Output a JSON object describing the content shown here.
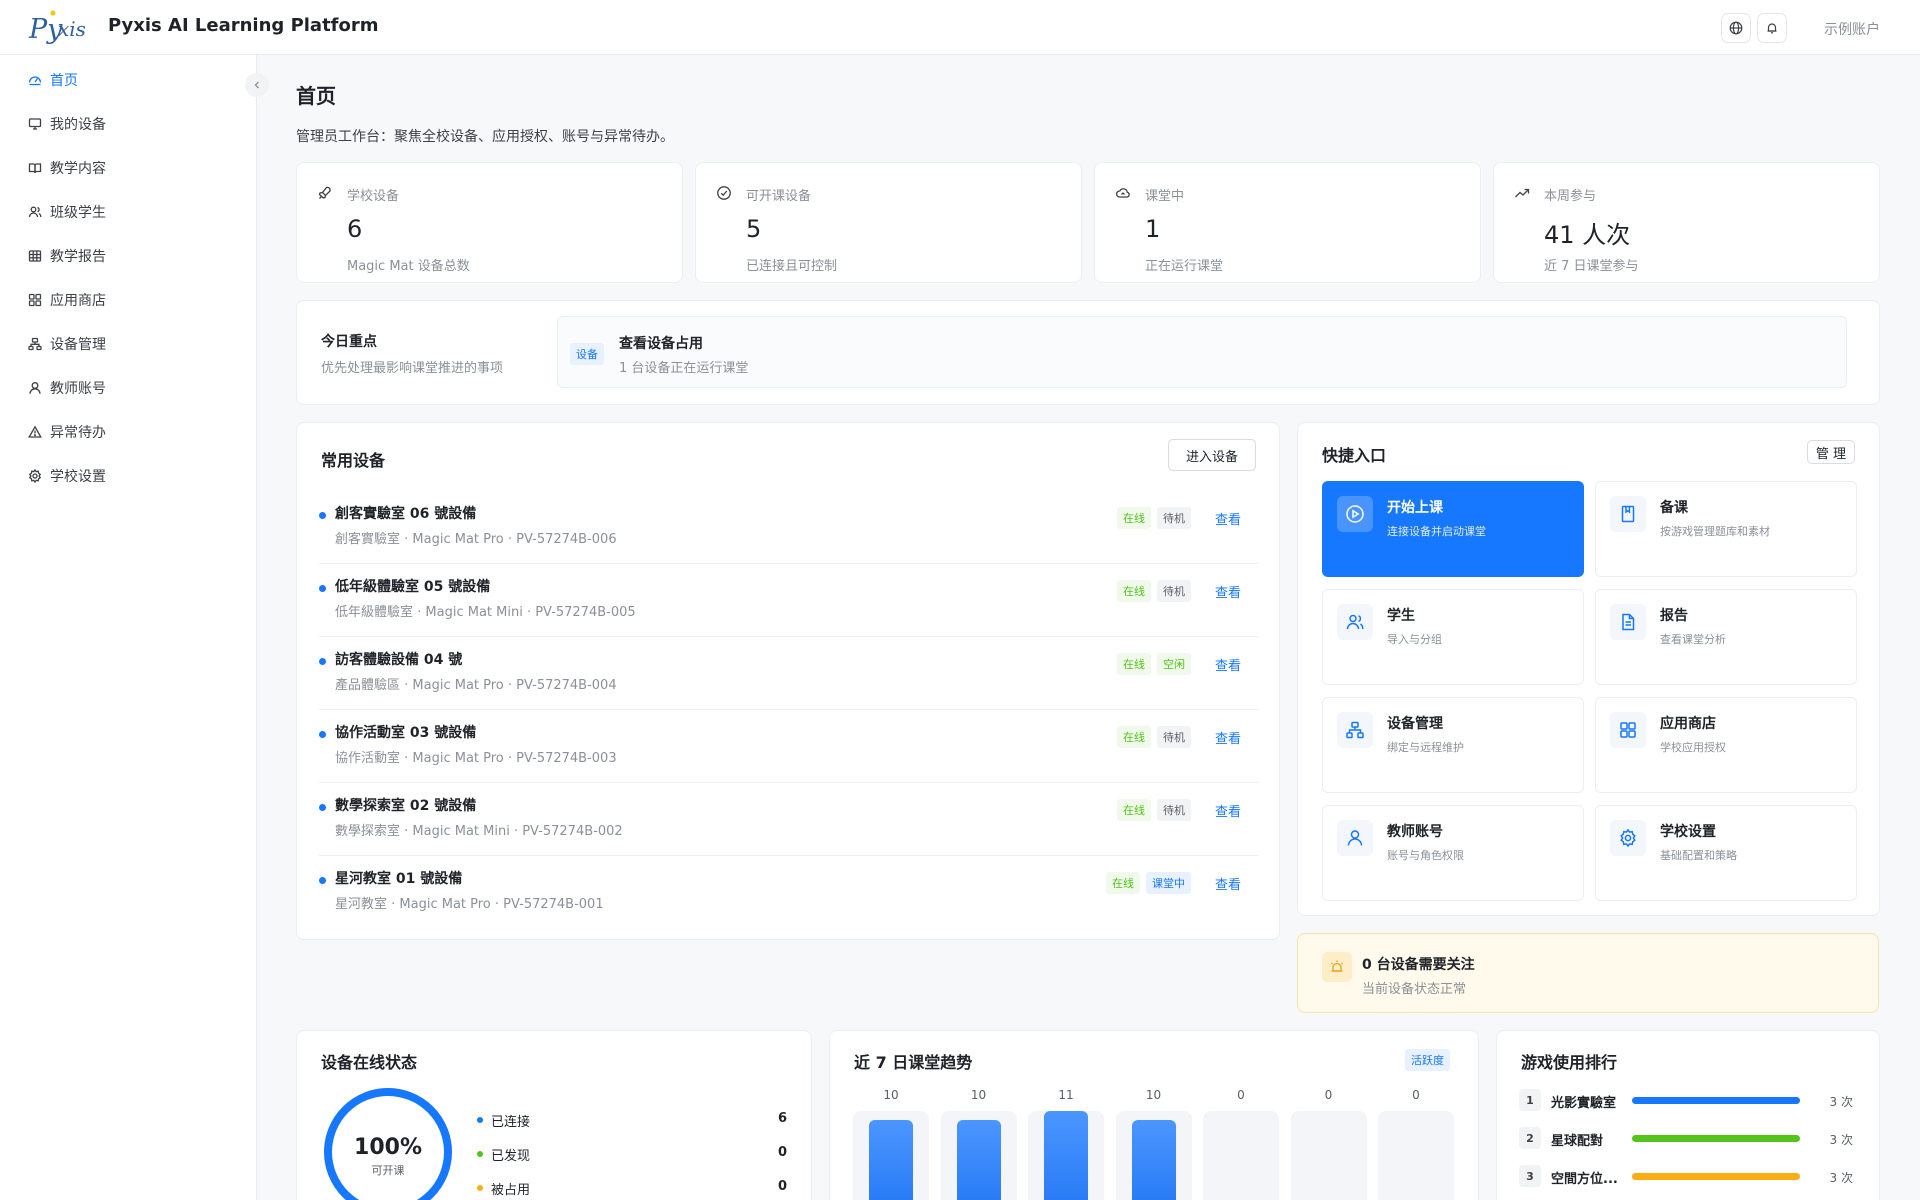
{
  "header": {
    "title": "Pyxis AI Learning Platform",
    "account": "示例账户"
  },
  "sidebar": {
    "items": [
      {
        "label": "首页",
        "icon": "dashboard-icon",
        "active": true
      },
      {
        "label": "我的设备",
        "icon": "monitor-icon"
      },
      {
        "label": "教学内容",
        "icon": "book-icon"
      },
      {
        "label": "班级学生",
        "icon": "students-icon"
      },
      {
        "label": "教学报告",
        "icon": "table-icon"
      },
      {
        "label": "应用商店",
        "icon": "apps-icon"
      },
      {
        "label": "设备管理",
        "icon": "org-icon"
      },
      {
        "label": "教师账号",
        "icon": "user-icon"
      },
      {
        "label": "异常待办",
        "icon": "warning-icon"
      },
      {
        "label": "学校设置",
        "icon": "gear-icon"
      }
    ]
  },
  "page": {
    "title": "首页",
    "subtitle": "管理员工作台：聚焦全校设备、应用授权、账号与异常待办。"
  },
  "stats": [
    {
      "label": "学校设备",
      "value": "6",
      "desc": "Magic Mat 设备总数",
      "icon": "rocket-icon"
    },
    {
      "label": "可开课设备",
      "value": "5",
      "desc": "已连接且可控制",
      "icon": "check-circle-icon"
    },
    {
      "label": "课堂中",
      "value": "1",
      "desc": "正在运行课堂",
      "icon": "cloud-icon"
    },
    {
      "label": "本周参与",
      "value": "41 人次",
      "desc": "近 7 日课堂参与",
      "icon": "trend-icon"
    }
  ],
  "focus": {
    "title": "今日重点",
    "subtitle": "优先处理最影响课堂推进的事项",
    "item": {
      "tag": "设备",
      "title": "查看设备占用",
      "desc": "1 台设备正在运行课堂"
    }
  },
  "devices": {
    "title": "常用设备",
    "enter_label": "进入设备",
    "view_label": "查看",
    "online_label": "在线",
    "rows": [
      {
        "name": "創客實驗室 06 號設備",
        "meta": "創客實驗室 · Magic Mat Pro · PV-57274B-006",
        "state": "待机",
        "state_kind": "idle"
      },
      {
        "name": "低年級體驗室 05 號設備",
        "meta": "低年級體驗室 · Magic Mat Mini · PV-57274B-005",
        "state": "待机",
        "state_kind": "idle"
      },
      {
        "name": "訪客體驗設備 04 號",
        "meta": "產品體驗區 · Magic Mat Pro · PV-57274B-004",
        "state": "空闲",
        "state_kind": "free"
      },
      {
        "name": "協作活動室 03 號設備",
        "meta": "協作活動室 · Magic Mat Pro · PV-57274B-003",
        "state": "待机",
        "state_kind": "idle"
      },
      {
        "name": "數學探索室 02 號設備",
        "meta": "數學探索室 · Magic Mat Mini · PV-57274B-002",
        "state": "待机",
        "state_kind": "idle"
      },
      {
        "name": "星河教室 01 號設備",
        "meta": "星河教室 · Magic Mat Pro · PV-57274B-001",
        "state": "课堂中",
        "state_kind": "class"
      }
    ]
  },
  "quick": {
    "title": "快捷入口",
    "manage_label": "管 理",
    "tiles": [
      {
        "title": "开始上课",
        "sub": "连接设备并启动课堂",
        "icon": "play-icon",
        "primary": true
      },
      {
        "title": "备课",
        "sub": "按游戏管理题库和素材",
        "icon": "bookmark-icon"
      },
      {
        "title": "学生",
        "sub": "导入与分组",
        "icon": "students-icon"
      },
      {
        "title": "报告",
        "sub": "查看课堂分析",
        "icon": "document-icon"
      },
      {
        "title": "设备管理",
        "sub": "绑定与远程维护",
        "icon": "org-icon"
      },
      {
        "title": "应用商店",
        "sub": "学校应用授权",
        "icon": "apps-icon"
      },
      {
        "title": "教师账号",
        "sub": "账号与角色权限",
        "icon": "user-icon"
      },
      {
        "title": "学校设置",
        "sub": "基础配置和策略",
        "icon": "gear-icon"
      }
    ]
  },
  "alert": {
    "title": "0 台设备需要关注",
    "sub": "当前设备状态正常"
  },
  "online_status": {
    "title": "设备在线状态",
    "percent": "100%",
    "percent_label": "可开课",
    "ratio": 1.0,
    "legend": [
      {
        "label": "已连接",
        "value": "6",
        "color": "#1677ff"
      },
      {
        "label": "已发现",
        "value": "0",
        "color": "#52c41a"
      },
      {
        "label": "被占用",
        "value": "0",
        "color": "#faad14"
      }
    ]
  },
  "trend": {
    "title": "近 7 日课堂趋势",
    "badge": "活跃度",
    "values": [
      10,
      10,
      11,
      10,
      0,
      0,
      0
    ]
  },
  "ranking": {
    "title": "游戏使用排行",
    "rows": [
      {
        "rank": "1",
        "name": "光影實驗室",
        "count": "3 次",
        "fraction": 1.0,
        "color": "#1677ff"
      },
      {
        "rank": "2",
        "name": "星球配對",
        "count": "3 次",
        "fraction": 1.0,
        "color": "#52c41a"
      },
      {
        "rank": "3",
        "name": "空間方位...",
        "count": "3 次",
        "fraction": 1.0,
        "color": "#faad14"
      }
    ]
  }
}
